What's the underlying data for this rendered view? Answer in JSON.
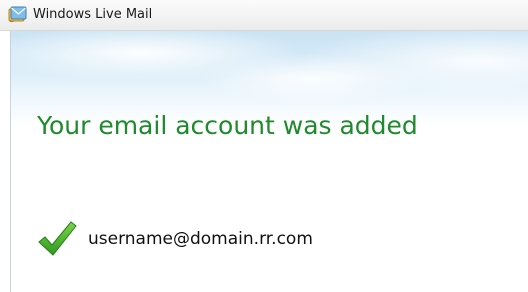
{
  "window": {
    "title": "Windows Live Mail",
    "app_icon": "windows-live-mail-icon"
  },
  "content": {
    "headline": "Your email account was added",
    "status_icon": "checkmark-icon",
    "account": "username@domain.rr.com"
  },
  "colors": {
    "headline": "#1e8a2c",
    "checkmark": "#3fae2a",
    "titlebar": "#f3f3f3"
  }
}
